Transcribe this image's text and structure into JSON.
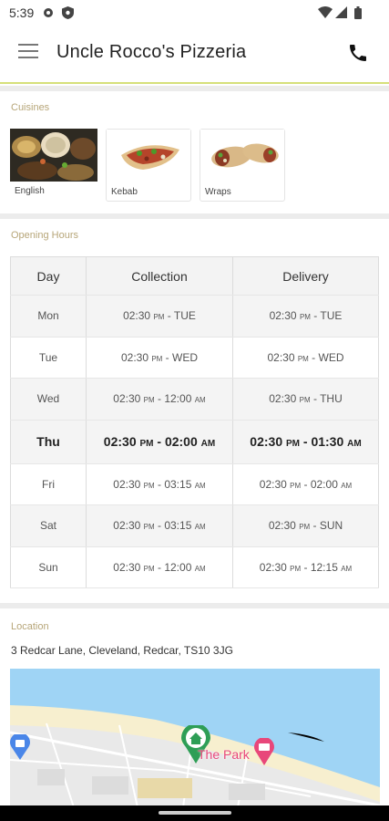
{
  "status_bar": {
    "time": "5:39"
  },
  "app_bar": {
    "title": "Uncle Rocco's Pizzeria"
  },
  "cuisines": {
    "label": "Cuisines",
    "items": [
      {
        "label": "English",
        "image": "english-food-photo"
      },
      {
        "label": "Kebab",
        "image": "kebab-wrap-photo"
      },
      {
        "label": "Wraps",
        "image": "wraps-photo"
      }
    ]
  },
  "opening_hours": {
    "label": "Opening Hours",
    "headers": {
      "day": "Day",
      "collection": "Collection",
      "delivery": "Delivery"
    },
    "rows": [
      {
        "day": "Mon",
        "collection": "02:30 PM - TUE",
        "delivery": "02:30 PM - TUE"
      },
      {
        "day": "Tue",
        "collection": "02:30 PM - WED",
        "delivery": "02:30 PM - WED"
      },
      {
        "day": "Wed",
        "collection": "02:30 PM - 12:00 AM",
        "delivery": "02:30 PM - THU"
      },
      {
        "day": "Thu",
        "collection": "02:30 PM - 02:00 AM",
        "delivery": "02:30 PM - 01:30 AM"
      },
      {
        "day": "Fri",
        "collection": "02:30 PM - 03:15 AM",
        "delivery": "02:30 PM - 02:00 AM"
      },
      {
        "day": "Sat",
        "collection": "02:30 PM - 03:15 AM",
        "delivery": "02:30 PM - SUN"
      },
      {
        "day": "Sun",
        "collection": "02:30 PM - 12:00 AM",
        "delivery": "02:30 PM - 12:15 AM"
      }
    ]
  },
  "location": {
    "label": "Location",
    "address": "3 Redcar Lane, Cleveland, Redcar, TS10 3JG",
    "map_label": "The Park"
  },
  "colors": {
    "accent_line": "#d6e07a",
    "section_label": "#b7a679",
    "sea": "#9fd4f5",
    "land": "#f7f3e6"
  }
}
